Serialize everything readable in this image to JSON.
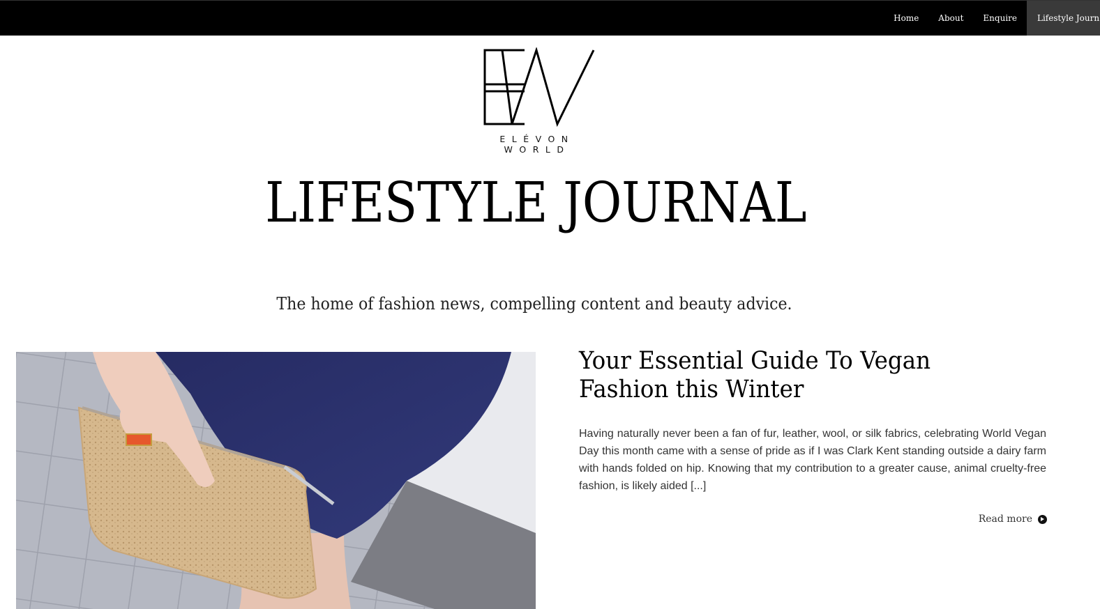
{
  "nav": {
    "items": [
      {
        "label": "Home"
      },
      {
        "label": "About"
      },
      {
        "label": "Enquire"
      },
      {
        "label": "Lifestyle Journ"
      }
    ]
  },
  "logo": {
    "wordmark": "ELÉVON WORLD",
    "icon": "ew-monogram-logo"
  },
  "header": {
    "title": "LIFESTYLE JOURNAL",
    "tagline": "The home of fashion news, compelling content and beauty advice."
  },
  "post": {
    "image_icon": "cork-clutch-photo",
    "title": "Your Essential Guide To Vegan Fashion this Winter",
    "excerpt": "Having naturally never been a fan of fur, leather, wool, or silk fabrics, celebrating World Vegan Day this month came with a sense of pride as if I was Clark Kent standing outside a dairy farm with hands folded on hip. Knowing that my contribution to a greater cause, animal cruelty-free fashion, is likely aided [...]",
    "read_more": "Read more",
    "read_more_icon": "arrow-circle-right-icon"
  },
  "colors": {
    "topbar": "#000000",
    "active_nav": "#3a3a3a",
    "dress": "#2a2f6b",
    "cork": "#d3b489"
  }
}
